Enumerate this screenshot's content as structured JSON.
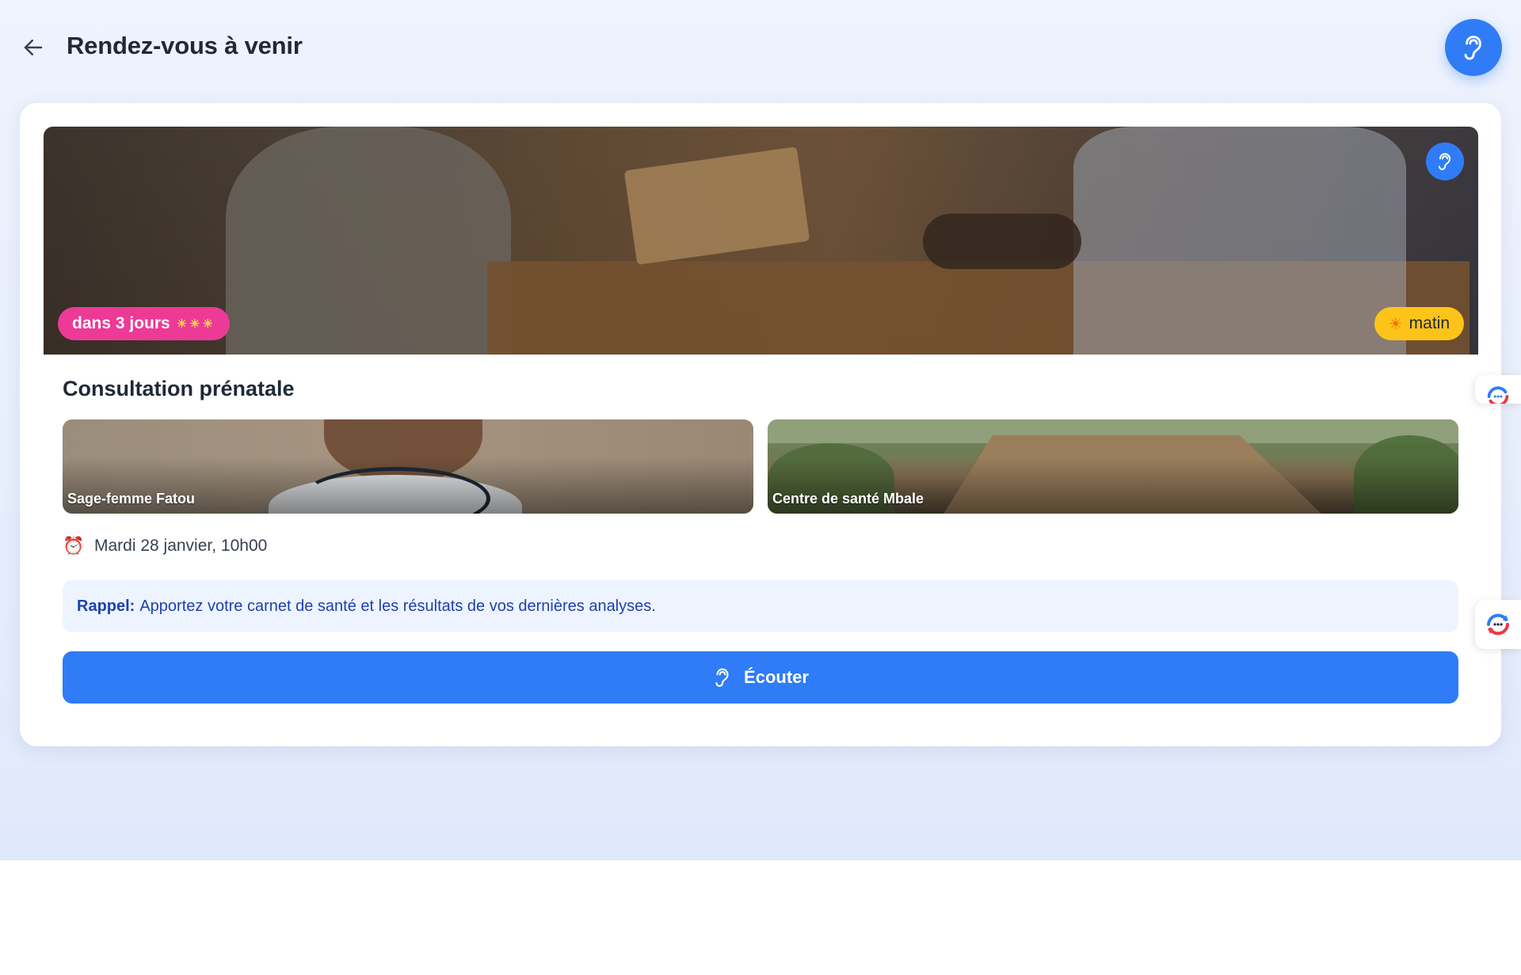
{
  "header": {
    "back_label": "",
    "title": "Rendez-vous à venir",
    "listen_icon": "ear-icon"
  },
  "appointment": {
    "hero": {
      "days_badge": "dans 3 jours",
      "days_badge_suns": "☀☀☀",
      "time_badge": "matin",
      "time_badge_icon": "☀"
    },
    "title": "Consultation prénatale",
    "midwife": {
      "caption": "Sage-femme Fatou"
    },
    "center": {
      "caption": "Centre de santé Mbale"
    },
    "datetime": "Mardi 28 janvier, 10h00",
    "reminder": {
      "lead": "Rappel:",
      "text": "Apportez votre carnet de santé et les résultats de vos dernières analyses."
    },
    "listen_button": "Écouter"
  },
  "colors": {
    "primary": "#2f7cf6",
    "days_badge": "#ec3a96",
    "time_badge": "#fcc419",
    "reminder_bg": "#eef4ff",
    "reminder_text": "#1e40af"
  }
}
